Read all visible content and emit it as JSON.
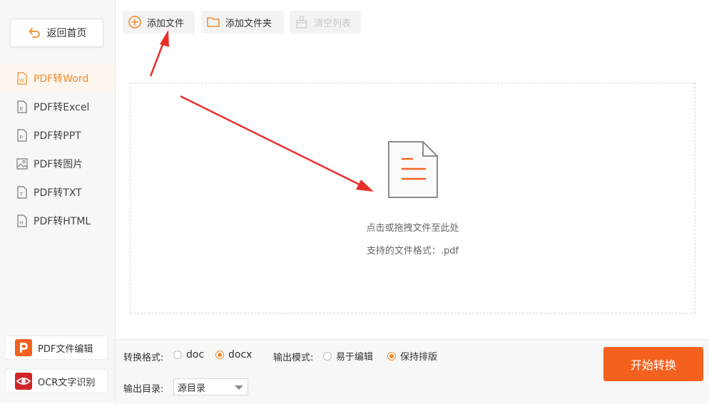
{
  "sidebar": {
    "back_label": "返回首页",
    "nav": [
      {
        "label": "PDF转Word",
        "icon": "word-doc-icon",
        "letter": "W"
      },
      {
        "label": "PDF转Excel",
        "icon": "excel-doc-icon",
        "letter": "E"
      },
      {
        "label": "PDF转PPT",
        "icon": "ppt-doc-icon",
        "letter": "P"
      },
      {
        "label": "PDF转图片",
        "icon": "image-icon",
        "letter": ""
      },
      {
        "label": "PDF转TXT",
        "icon": "txt-doc-icon",
        "letter": "T"
      },
      {
        "label": "PDF转HTML",
        "icon": "html-doc-icon",
        "letter": "H"
      }
    ],
    "tools": {
      "pdf_editor": "PDF文件编辑",
      "ocr": "OCR文字识别"
    }
  },
  "toolbar": {
    "add_file": "添加文件",
    "add_folder": "添加文件夹",
    "clear_list": "清空列表"
  },
  "dropzone": {
    "hint": "点击或拖拽文件至此处",
    "formats": "支持的文件格式：.pdf"
  },
  "options": {
    "format_label": "转换格式:",
    "format_doc": "doc",
    "format_docx": "docx",
    "mode_label": "输出模式:",
    "mode_edit": "易于编辑",
    "mode_keep": "保持排版",
    "dir_label": "输出目录:",
    "dir_value": "源目录"
  },
  "start_label": "开始转换",
  "colors": {
    "accent": "#f08a2c",
    "start_button": "#f4611f",
    "arrow": "#e8302a"
  }
}
